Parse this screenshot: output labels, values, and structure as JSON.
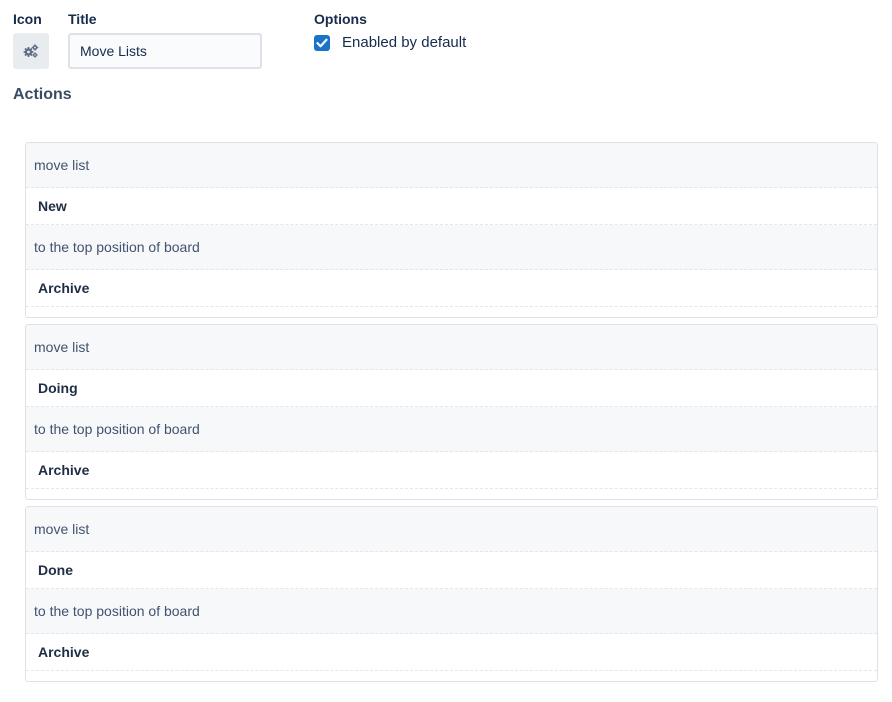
{
  "form": {
    "icon_label": "Icon",
    "title_label": "Title",
    "options_label": "Options",
    "title_value": "Move Lists",
    "icon_name": "gears-icon",
    "option_enabled_label": "Enabled by default",
    "option_enabled_checked": true,
    "actions_heading": "Actions"
  },
  "actions": [
    {
      "verb": "move list",
      "list": "New",
      "where": "to the top position of board",
      "board": "Archive"
    },
    {
      "verb": "move list",
      "list": "Doing",
      "where": "to the top position of board",
      "board": "Archive"
    },
    {
      "verb": "move list",
      "list": "Done",
      "where": "to the top position of board",
      "board": "Archive"
    }
  ],
  "colors": {
    "checkbox": "#1a73c9",
    "text": "#172b4d",
    "row_alt": "#f7f8fa"
  }
}
